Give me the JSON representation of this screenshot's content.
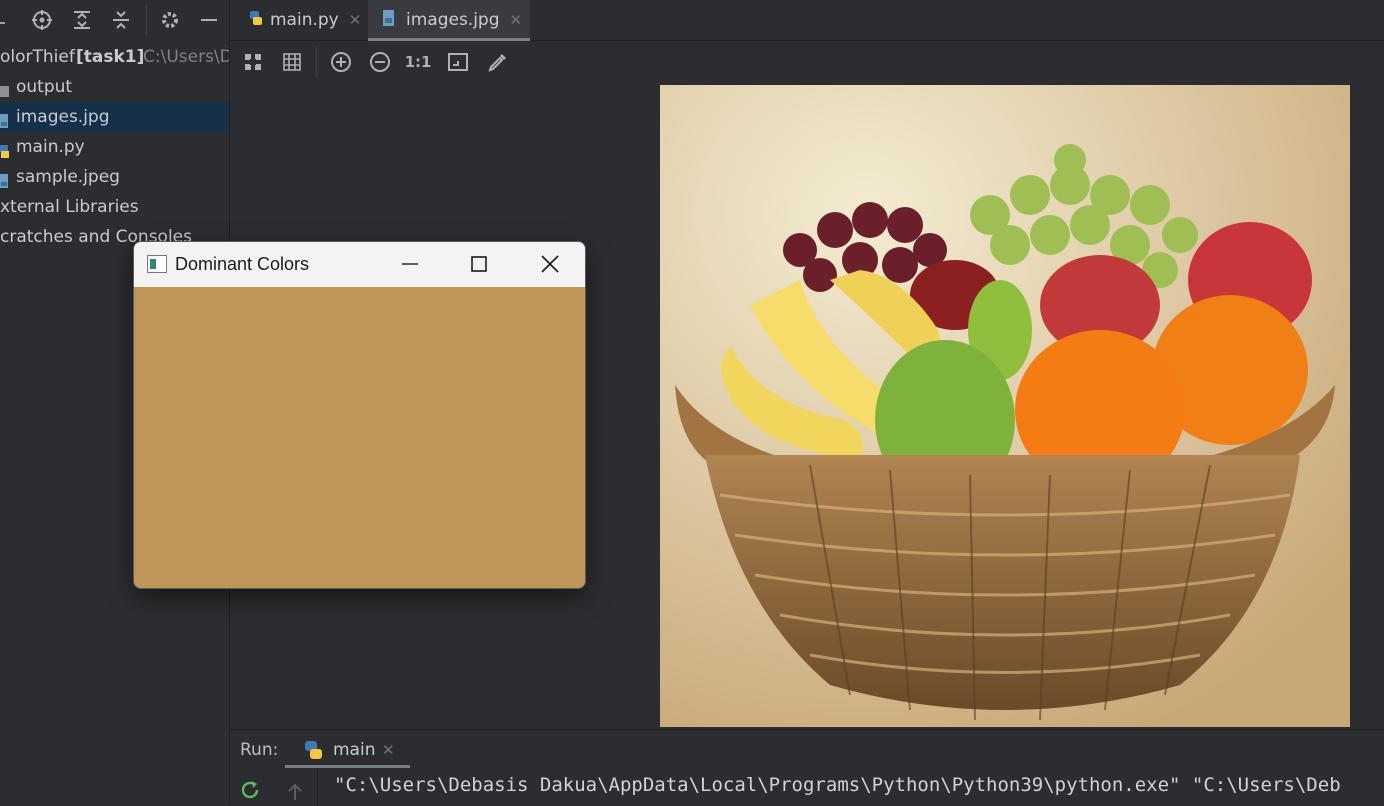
{
  "sidebar": {
    "project_name": "olorThief",
    "branch": "[task1]",
    "path": "C:\\Users\\D",
    "items": [
      {
        "label": "output",
        "icon": "folder-icon"
      },
      {
        "label": "images.jpg",
        "icon": "image-file-icon",
        "selected": true
      },
      {
        "label": "main.py",
        "icon": "python-file-icon"
      },
      {
        "label": "sample.jpeg",
        "icon": "image-file-icon"
      },
      {
        "label": "xternal Libraries",
        "icon": "library-icon"
      },
      {
        "label": "cratches and Consoles",
        "icon": "scratches-icon"
      }
    ],
    "toolbar_icons": [
      "locate-icon",
      "expand-all-icon",
      "collapse-all-icon",
      "gear-icon",
      "minimize-icon"
    ]
  },
  "tabs": [
    {
      "label": "main.py",
      "icon": "python-file-icon",
      "active": false
    },
    {
      "label": "images.jpg",
      "icon": "image-file-icon",
      "active": true
    }
  ],
  "image_toolbar": {
    "icons": [
      "fit-icon",
      "grid-icon",
      "zoom-in-icon",
      "zoom-out-icon",
      "actual-size-icon",
      "fit-window-icon",
      "color-picker-icon"
    ],
    "actual_size_label": "1:1"
  },
  "run": {
    "label": "Run:",
    "tab_label": "main",
    "console_text": "\"C:\\Users\\Debasis Dakua\\AppData\\Local\\Programs\\Python\\Python39\\python.exe\" \"C:\\Users\\Deb"
  },
  "dialog": {
    "title": "Dominant Colors",
    "color": "#bf9658"
  },
  "colors": {
    "background": "#2b2d30",
    "selection": "#163049",
    "dominant": "#bf9658"
  }
}
